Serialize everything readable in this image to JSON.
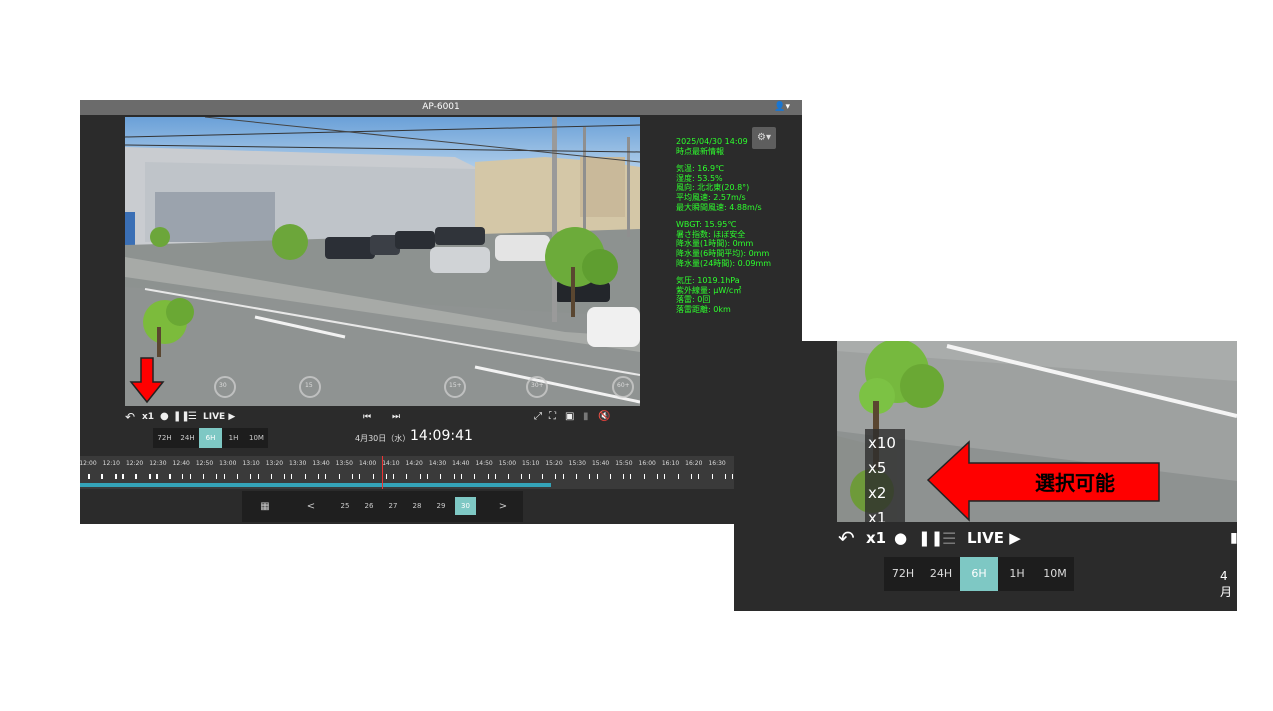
{
  "window": {
    "title": "AP-6001",
    "user_menu": "▾"
  },
  "sensor": {
    "datetime": "2025/04/30 14:09",
    "subtitle": "時点最新情報",
    "lines1": [
      "気温: 16.9℃",
      "湿度: 53.5%",
      "風向: 北北東(20.8°)",
      "平均風速: 2.57m/s",
      "最大瞬間風速: 4.88m/s"
    ],
    "lines2": [
      "WBGT: 15.95℃",
      "暑さ指数: ほぼ安全",
      "降水量(1時間): 0mm",
      "降水量(6時間平均): 0mm",
      "降水量(24時間): 0.09mm"
    ],
    "lines3": [
      "気圧: 1019.1hPa",
      "紫外線量: μW/c㎡",
      "落雷: 0回",
      "落雷距離: 0km"
    ],
    "settings_icon": "gear-icon"
  },
  "video_overlay": {
    "skip_labels": [
      "30",
      "15",
      "15+",
      "30+",
      "60+"
    ]
  },
  "controls": {
    "speed": "x1",
    "live": "LIVE ▶",
    "ranges": [
      "72H",
      "24H",
      "6H",
      "1H",
      "10M"
    ],
    "active_range": "6H",
    "date": "4月30日（水）",
    "time": "14:09:41"
  },
  "timeline": {
    "ticks": [
      "12:00",
      "12:10",
      "12:20",
      "12:30",
      "12:40",
      "12:50",
      "13:00",
      "13:10",
      "13:20",
      "13:30",
      "13:40",
      "13:50",
      "14:00",
      "14:10",
      "14:20",
      "14:30",
      "14:40",
      "14:50",
      "15:00",
      "15:10",
      "15:20",
      "15:30",
      "15:40",
      "15:50",
      "16:00",
      "16:10",
      "16:20",
      "16:30"
    ],
    "progress": 0.72
  },
  "datebar": {
    "days": [
      "25",
      "26",
      "27",
      "28",
      "29",
      "30"
    ],
    "active_day": "30",
    "prev": "<",
    "next": ">"
  },
  "inset": {
    "speed_options": [
      "x10",
      "x5",
      "x2",
      "x1"
    ],
    "speed": "x1",
    "live": "LIVE ▶",
    "ranges": [
      "72H",
      "24H",
      "6H",
      "1H",
      "10M"
    ],
    "date_partial": "4月"
  },
  "callout": {
    "text": "選択可能",
    "color": "#ff0000"
  }
}
